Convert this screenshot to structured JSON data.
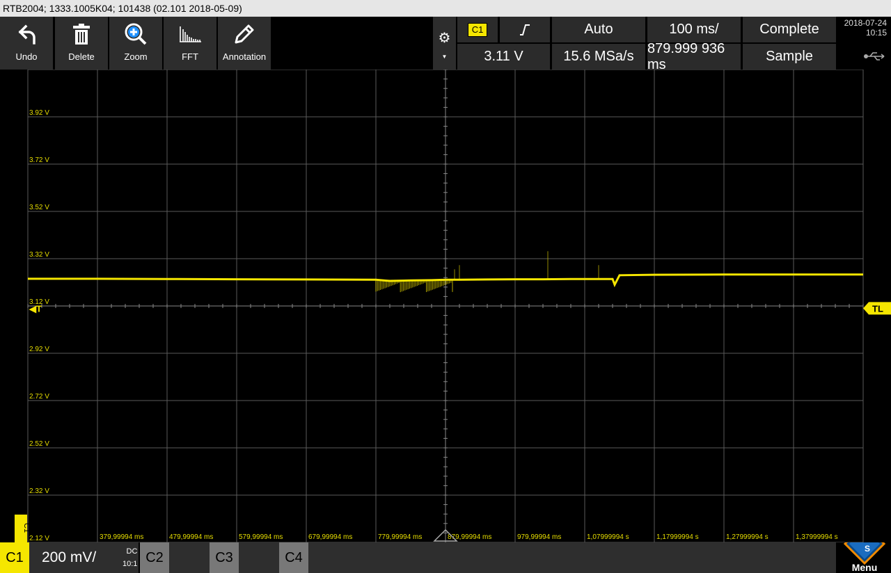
{
  "title": "RTB2004; 1333.1005K04; 101438 (02.101 2018-05-09)",
  "toolbar": {
    "undo_label": "Undo",
    "delete_label": "Delete",
    "zoom_label": "Zoom",
    "fft_label": "FFT",
    "annotation_label": "Annotation"
  },
  "trigger": {
    "source": "C1",
    "slope_icon": "rising-edge-icon",
    "mode": "Auto",
    "level": "3.11 V"
  },
  "acquisition": {
    "timebase": "100 ms/",
    "sample_rate": "15.6 MSa/s",
    "state": "Complete",
    "position": "879.999 936 ms",
    "mode": "Sample"
  },
  "status": {
    "date": "2018-07-24",
    "time": "10:15",
    "usb_icon": "usb-icon"
  },
  "markers": {
    "trigger_left": "T",
    "trigger_right": "TL",
    "channel_tab": "C1"
  },
  "channel1": {
    "label": "C1",
    "scale": "200 mV/",
    "coupling": "DC",
    "probe": "10:1"
  },
  "channels_off": [
    "C2",
    "C3",
    "C4"
  ],
  "menu_label": "Menu",
  "colors": {
    "trace": "#f5e600",
    "grid": "#5a5a5a",
    "label": "#e8df00",
    "panel": "#2d2d2d"
  },
  "chart_data": {
    "type": "line",
    "y_labels": [
      "3.92 V",
      "3.72 V",
      "3.52 V",
      "3.32 V",
      "3.12 V",
      "2.92 V",
      "2.72 V",
      "2.52 V",
      "2.32 V",
      "2.12 V"
    ],
    "x_labels": [
      "379,99994 ms",
      "479,99994 ms",
      "579,99994 ms",
      "679,99994 ms",
      "779,99994 ms",
      "879,99994 ms",
      "979,99994 ms",
      "1,07999994 s",
      "1,17999994 s",
      "1,27999994 s",
      "1,37999994 s"
    ],
    "x_unit": "s",
    "y_unit": "V",
    "xlim": [
      0.28,
      1.48
    ],
    "ylim": [
      2.12,
      4.12
    ],
    "trigger_level": 3.11,
    "series": [
      {
        "x": [
          0.28,
          0.38,
          0.48,
          0.58,
          0.68,
          0.78,
          0.8,
          0.83,
          0.86,
          0.88,
          0.9,
          0.94,
          0.98,
          1.02,
          1.06,
          1.1,
          1.12,
          1.123,
          1.13,
          1.18,
          1.28,
          1.38,
          1.48
        ],
        "y": [
          3.235,
          3.235,
          3.234,
          3.233,
          3.232,
          3.231,
          3.226,
          3.228,
          3.229,
          3.231,
          3.231,
          3.232,
          3.233,
          3.233,
          3.234,
          3.234,
          3.234,
          3.21,
          3.25,
          3.252,
          3.253,
          3.253,
          3.253
        ]
      }
    ]
  }
}
